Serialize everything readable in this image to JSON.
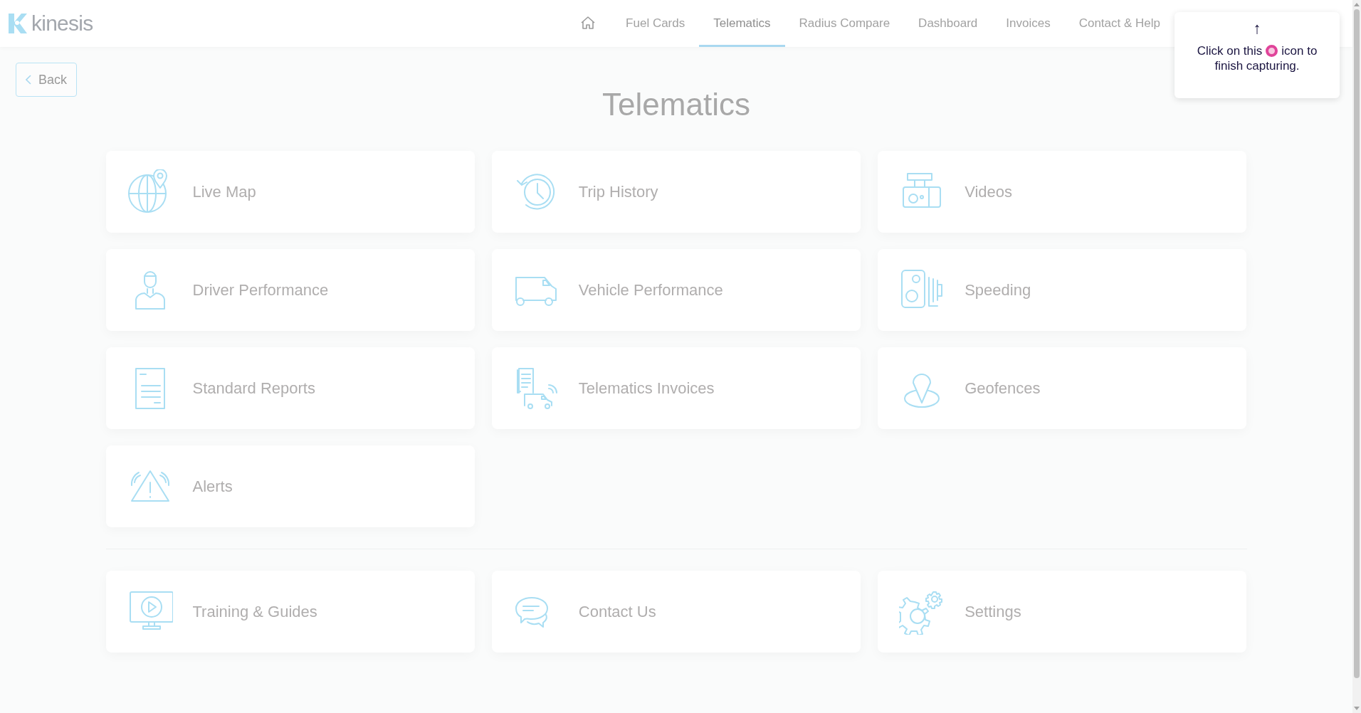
{
  "header": {
    "logo_text": "kinesis",
    "nav": [
      {
        "kind": "home",
        "selected": false
      },
      {
        "kind": "link",
        "label": "Fuel Cards",
        "selected": false
      },
      {
        "kind": "link",
        "label": "Telematics",
        "selected": true
      },
      {
        "kind": "link",
        "label": "Radius Compare",
        "selected": false
      },
      {
        "kind": "link",
        "label": "Dashboard",
        "selected": false
      },
      {
        "kind": "link",
        "label": "Invoices",
        "selected": false
      },
      {
        "kind": "link",
        "label": "Contact & Help",
        "selected": false
      }
    ]
  },
  "back_button": "Back",
  "title": "Telematics",
  "tiles": [
    {
      "kind": "globe",
      "label": "Live Map"
    },
    {
      "kind": "history",
      "label": "Trip History"
    },
    {
      "kind": "dashcam",
      "label": "Videos"
    },
    {
      "kind": "driver",
      "label": "Driver Performance"
    },
    {
      "kind": "van",
      "label": "Vehicle Performance"
    },
    {
      "kind": "speedcam",
      "label": "Speeding"
    },
    {
      "kind": "document",
      "label": "Standard Reports"
    },
    {
      "kind": "invoice",
      "label": "Telematics Invoices"
    },
    {
      "kind": "pin",
      "label": "Geofences"
    },
    {
      "kind": "alert",
      "label": "Alerts"
    }
  ],
  "bottom_tiles": [
    {
      "kind": "monitor",
      "label": "Training & Guides"
    },
    {
      "kind": "chat",
      "label": "Contact Us"
    },
    {
      "kind": "gears",
      "label": "Settings"
    }
  ],
  "capture_tip": {
    "arrow": "↑",
    "text_before": "Click on this",
    "text_after": "icon to",
    "line_2": "finish capturing."
  }
}
